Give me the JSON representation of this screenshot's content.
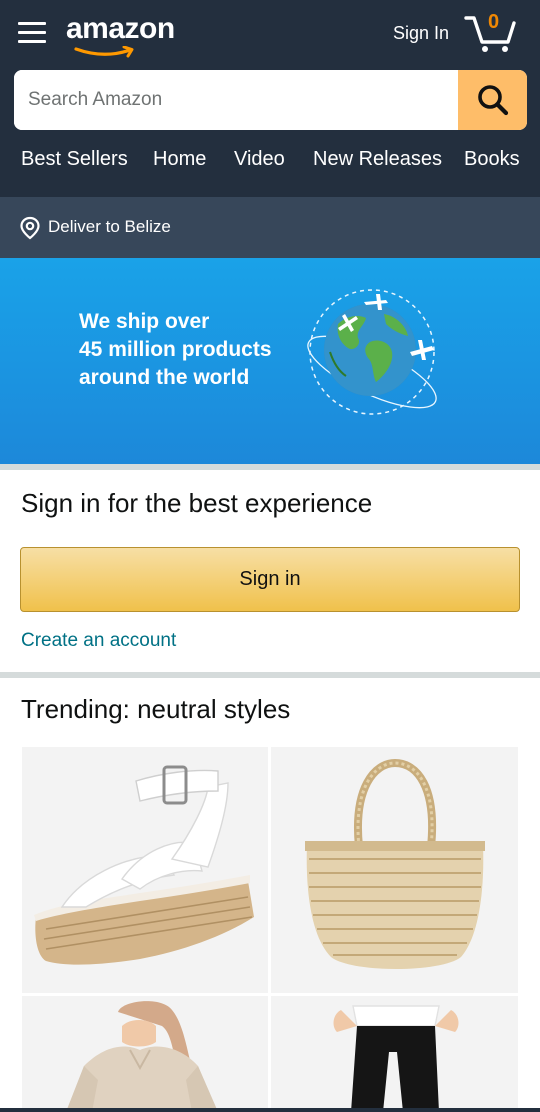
{
  "header": {
    "logo_text": "amazon",
    "signin_label": "Sign In",
    "cart_count": "0"
  },
  "search": {
    "placeholder": "Search Amazon"
  },
  "nav": {
    "items": [
      "Best Sellers",
      "Home",
      "Video",
      "New Releases",
      "Books"
    ]
  },
  "delivery": {
    "label": "Deliver to Belize"
  },
  "banner": {
    "line1": "We ship over",
    "line2": "45 million products",
    "line3": "around the world"
  },
  "signin_card": {
    "heading": "Sign in for the best experience",
    "button_label": "Sign in",
    "create_account_label": "Create an account"
  },
  "trending": {
    "heading": "Trending: neutral styles",
    "products": [
      {
        "icon": "wedge-sandal-image"
      },
      {
        "icon": "straw-basket-bag-image"
      },
      {
        "icon": "linen-top-image"
      },
      {
        "icon": "black-pants-image"
      }
    ]
  },
  "colors": {
    "header_bg": "#232f3e",
    "delivery_bg": "#37475a",
    "search_button": "#febd69",
    "cart_count": "#f08804",
    "link": "#007185",
    "signin_button": "#f0c14b",
    "banner_bg": "#1b93e0"
  }
}
